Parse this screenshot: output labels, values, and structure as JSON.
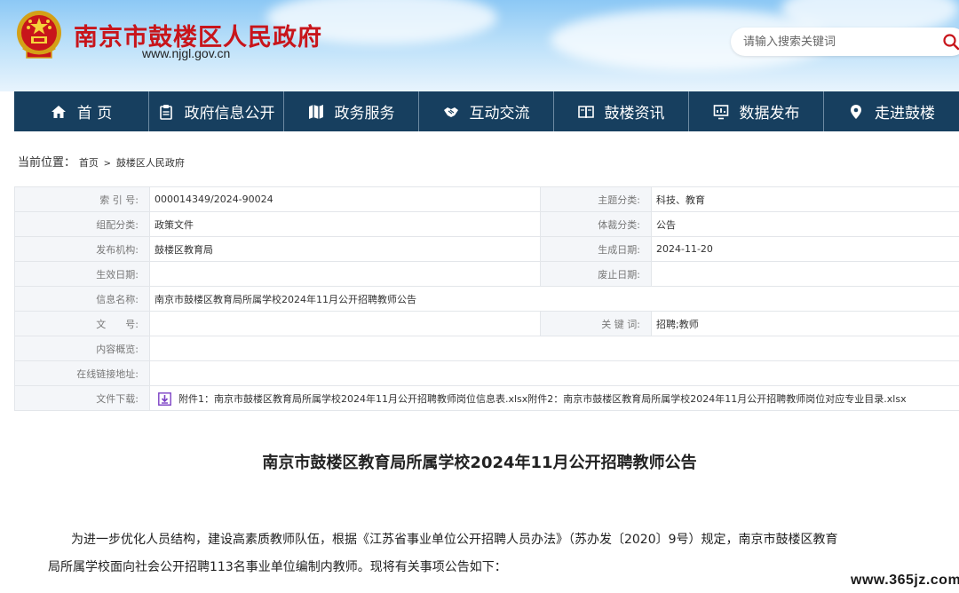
{
  "site": {
    "name": "南京市鼓楼区人民政府",
    "url": "www.njgl.gov.cn",
    "search_placeholder": "请输入搜索关键词",
    "emblem_icon": "national-emblem-icon"
  },
  "nav": [
    {
      "label": "首 页",
      "icon": "home-icon"
    },
    {
      "label": "政府信息公开",
      "icon": "clipboard-icon"
    },
    {
      "label": "政务服务",
      "icon": "map-icon"
    },
    {
      "label": "互动交流",
      "icon": "handshake-icon"
    },
    {
      "label": "鼓楼资讯",
      "icon": "book-icon"
    },
    {
      "label": "数据发布",
      "icon": "chart-icon"
    },
    {
      "label": "走进鼓楼",
      "icon": "location-pin-icon"
    }
  ],
  "breadcrumb": {
    "label": "当前位置：",
    "items": [
      "首页",
      "鼓楼区人民政府"
    ],
    "separator": ">"
  },
  "info": {
    "index_label": "索 引 号:",
    "index_value": "000014349/2024-90024",
    "topic_label": "主题分类:",
    "topic_value": "科技、教育",
    "org_class_label": "组配分类:",
    "org_class_value": "政策文件",
    "genre_label": "体裁分类:",
    "genre_value": "公告",
    "publisher_label": "发布机构:",
    "publisher_value": "鼓楼区教育局",
    "created_label": "生成日期:",
    "created_value": "2024-11-20",
    "effective_label": "生效日期:",
    "effective_value": "",
    "repeal_label": "废止日期:",
    "repeal_value": "",
    "name_label": "信息名称:",
    "name_value": "南京市鼓楼区教育局所属学校2024年11月公开招聘教师公告",
    "doc_no_label": "文　　号:",
    "doc_no_value": "",
    "keywords_label": "关 键 词:",
    "keywords_value": "招聘;教师",
    "summary_label": "内容概览:",
    "summary_value": "",
    "link_label": "在线链接地址:",
    "link_value": "",
    "download_label": "文件下载:",
    "download_value": "附件1：南京市鼓楼区教育局所属学校2024年11月公开招聘教师岗位信息表.xlsx附件2：南京市鼓楼区教育局所属学校2024年11月公开招聘教师岗位对应专业目录.xlsx"
  },
  "article": {
    "title": "南京市鼓楼区教育局所属学校2024年11月公开招聘教师公告",
    "para_line1": "为进一步优化人员结构，建设高素质教师队伍，根据《江苏省事业单位公开招聘人员办法》（苏办发〔2020〕9号）规定，南京市鼓楼区教育",
    "para_line2": "局所属学校面向社会公开招聘113名事业单位编制内教师。现将有关事项公告如下："
  },
  "watermark": "www.365jz.com",
  "colors": {
    "nav_bg": "#173f5f",
    "site_name": "#c8151b",
    "header_sky": "#8cc8f5",
    "search_icon": "#c8151b"
  }
}
